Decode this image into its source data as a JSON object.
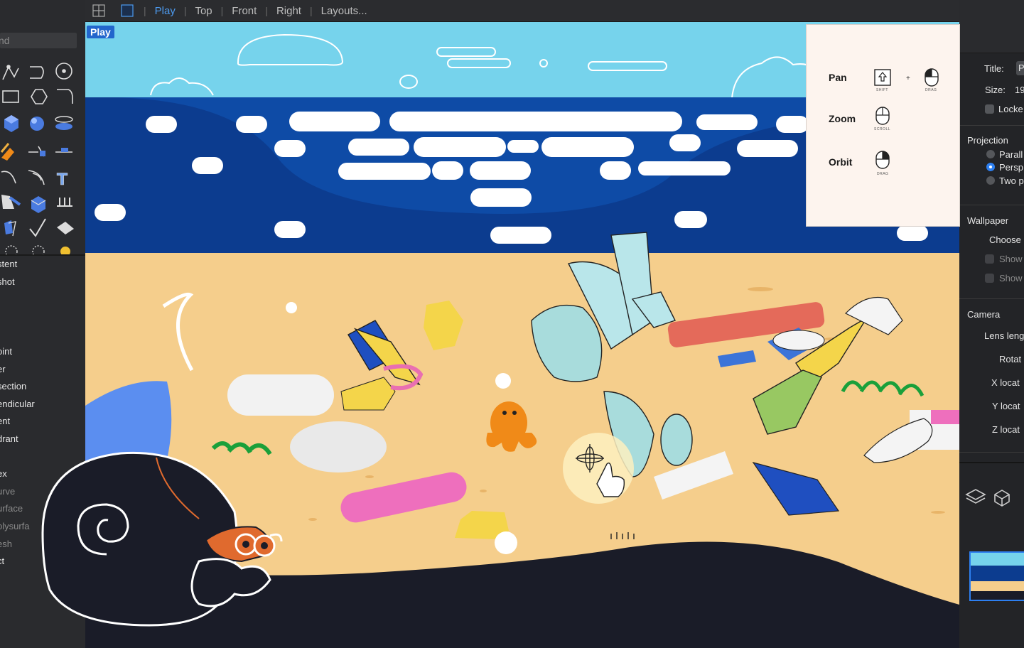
{
  "topbar": {
    "tabs": [
      {
        "label": "Play",
        "active": true
      },
      {
        "label": "Top",
        "active": false
      },
      {
        "label": "Front",
        "active": false
      },
      {
        "label": "Right",
        "active": false
      },
      {
        "label": "Layouts...",
        "active": false
      }
    ]
  },
  "viewport": {
    "label": "Play"
  },
  "command": {
    "placeholder": "nd"
  },
  "osnap": {
    "items": [
      {
        "label": "stent",
        "dim": false
      },
      {
        "label": "shot",
        "dim": false
      },
      {
        "label": "",
        "dim": false
      },
      {
        "label": "",
        "dim": false
      },
      {
        "label": "",
        "dim": false
      },
      {
        "label": "oint",
        "dim": false
      },
      {
        "label": "er",
        "dim": false
      },
      {
        "label": "section",
        "dim": false
      },
      {
        "label": "endicular",
        "dim": false
      },
      {
        "label": "ent",
        "dim": false
      },
      {
        "label": "drant",
        "dim": false
      },
      {
        "label": "",
        "dim": false
      },
      {
        "label": "ex",
        "dim": false
      },
      {
        "label": "urve",
        "dim": true
      },
      {
        "label": "urface",
        "dim": true
      },
      {
        "label": "olysurfa",
        "dim": true
      },
      {
        "label": "esh",
        "dim": true
      },
      {
        "label": "ct",
        "dim": false
      }
    ]
  },
  "navigation_hint": {
    "pan": {
      "label": "Pan",
      "key1": "SHIFT",
      "plus": "+",
      "key2": "DRAG"
    },
    "zoom": {
      "label": "Zoom",
      "key": "SCROLL"
    },
    "orbit": {
      "label": "Orbit",
      "key": "DRAG"
    }
  },
  "properties": {
    "title_label": "Title:",
    "title_value": "P",
    "size_label": "Size:",
    "size_value": "19",
    "locked_label": "Locke",
    "projection": {
      "header": "Projection",
      "options": [
        {
          "label": "Parall",
          "selected": false
        },
        {
          "label": "Persp",
          "selected": true
        },
        {
          "label": "Two p",
          "selected": false
        }
      ]
    },
    "wallpaper": {
      "header": "Wallpaper",
      "choose": "Choose",
      "show1": "Show",
      "show2": "Show"
    },
    "camera": {
      "header": "Camera",
      "lens": "Lens leng",
      "rotate": "Rotat",
      "x": "X locat",
      "y": "Y locat",
      "z": "Z locat"
    }
  },
  "colors": {
    "sky": "#76d3ec",
    "sea": "#0c3c8f",
    "sand": "#f5ce8c",
    "accent": "#4d9bf0",
    "dark": "#1a1c28"
  }
}
